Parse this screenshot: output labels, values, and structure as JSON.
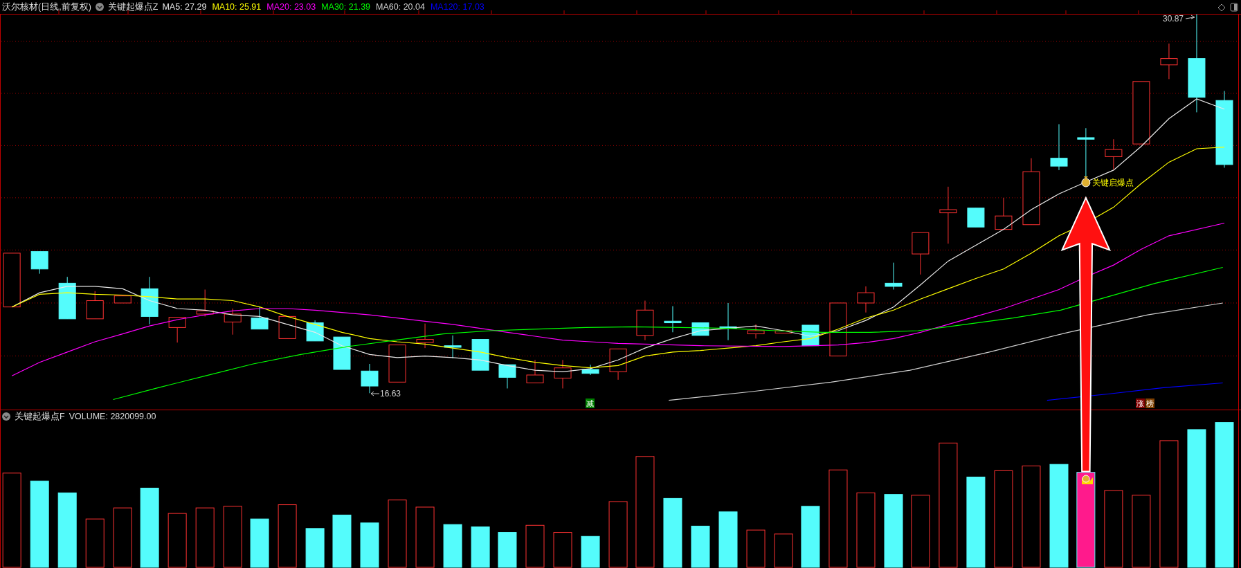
{
  "header": {
    "title": "沃尔核材(日线,前复权)",
    "indicator": "关键起爆点Z",
    "moving_averages": [
      {
        "label": "MA5: 27.29",
        "color": "#e8e8e8"
      },
      {
        "label": "MA10: 25.91",
        "color": "#ffff00"
      },
      {
        "label": "MA20: 23.03",
        "color": "#ff00ff"
      },
      {
        "label": "MA30: 21.39",
        "color": "#00ff00"
      },
      {
        "label": "MA60: 20.04",
        "color": "#d0d0d0"
      },
      {
        "label": "MA120: 17.03",
        "color": "#0000ff"
      }
    ]
  },
  "price_chart": {
    "high_label": "30.87",
    "low_label": "16.63",
    "signal_label": "关键启爆点",
    "badges": [
      {
        "text": "减",
        "color": "#008000"
      },
      {
        "text": "涨",
        "color": "#800000"
      },
      {
        "text": "榜",
        "color": "#804000"
      }
    ]
  },
  "volume_panel": {
    "indicator": "关键起爆点F",
    "volume_label": "VOLUME: 2820099.00"
  }
}
